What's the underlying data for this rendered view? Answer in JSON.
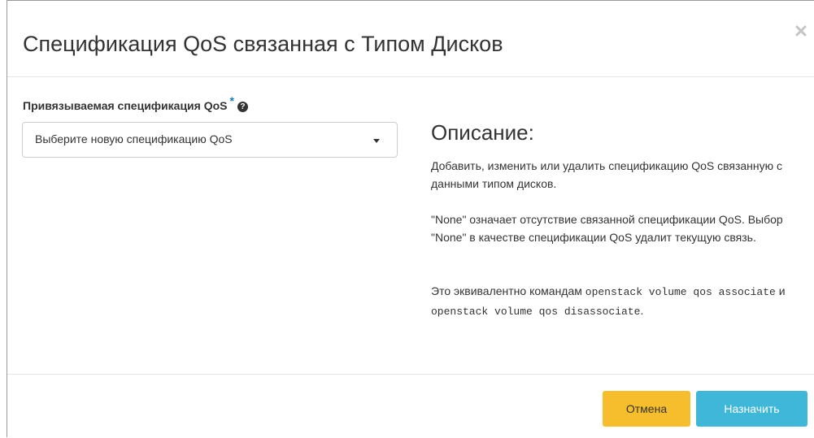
{
  "modal": {
    "title": "Спецификация QoS связанная с Типом Дисков",
    "close_icon": "close-icon"
  },
  "form": {
    "label": "Привязываемая спецификация QoS",
    "required_mark": "*",
    "help_icon": "question-circle-icon",
    "help_glyph": "?",
    "select": {
      "selected": "Выберите новую спецификацию QoS",
      "caret_icon": "chevron-down-icon"
    }
  },
  "description": {
    "heading": "Описание:",
    "p1": "Добавить, изменить или удалить спецификацию QoS связанную с данными типом дисков.",
    "p2": "\"None\" означает отсутствие связанной спецификации QoS. Выбор \"None\" в качестве спецификации QoS удалит текущую связь.",
    "p3_prefix": "Это эквивалентно командам",
    "p3_code1": "openstack volume qos associate",
    "p3_and": "и",
    "p3_code2": "openstack volume qos disassociate",
    "p3_suffix": "."
  },
  "footer": {
    "cancel_label": "Отмена",
    "submit_label": "Назначить"
  },
  "colors": {
    "required": "#0b7fc1",
    "cancel_bg": "#f6be2d",
    "submit_bg": "#3fb7d9"
  }
}
